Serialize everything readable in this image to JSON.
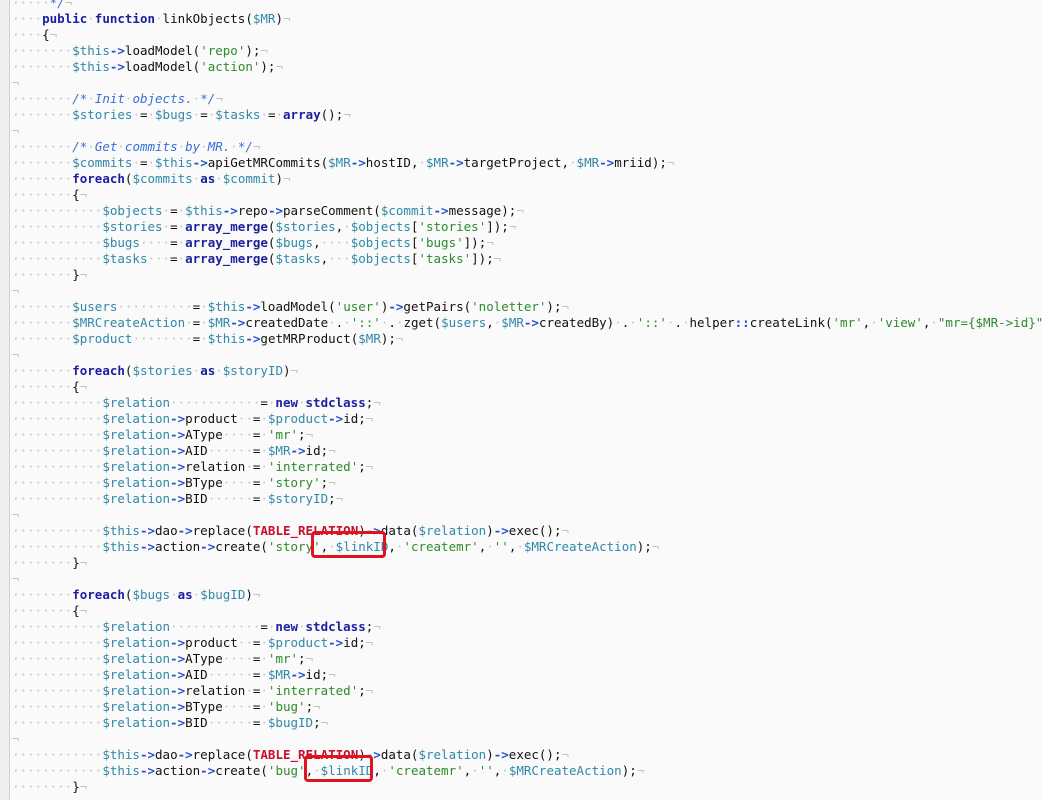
{
  "editor": {
    "lines": [
      "     */",
      "    public function linkObjects($MR)",
      "    {",
      "        $this->loadModel('repo');",
      "        $this->loadModel('action');",
      "",
      "        /* Init objects. */",
      "        $stories = $bugs = $tasks = array();",
      "",
      "        /* Get commits by MR. */",
      "        $commits = $this->apiGetMRCommits($MR->hostID, $MR->targetProject, $MR->mriid);",
      "        foreach($commits as $commit)",
      "        {",
      "            $objects = $this->repo->parseComment($commit->message);",
      "            $stories = array_merge($stories, $objects['stories']);",
      "            $bugs    = array_merge($bugs,    $objects['bugs']);",
      "            $tasks   = array_merge($tasks,   $objects['tasks']);",
      "        }",
      "",
      "        $users          = $this->loadModel('user')->getPairs('noletter');",
      "        $MRCreateAction = $MR->createdDate . '::' . zget($users, $MR->createdBy) . '::' . helper::createLink('mr', 'view', \"mr={$MR->id}\");",
      "        $product        = $this->getMRProduct($MR);",
      "",
      "        foreach($stories as $storyID)",
      "        {",
      "            $relation            = new stdclass;",
      "            $relation->product  = $product->id;",
      "            $relation->AType    = 'mr';",
      "            $relation->AID      = $MR->id;",
      "            $relation->relation = 'interrated';",
      "            $relation->BType    = 'story';",
      "            $relation->BID      = $storyID;",
      "",
      "            $this->dao->replace(TABLE_RELATION)->data($relation)->exec();",
      "            $this->action->create('story', $linkID, 'createmr', '', $MRCreateAction);",
      "        }",
      "",
      "        foreach($bugs as $bugID)",
      "        {",
      "            $relation            = new stdclass;",
      "            $relation->product  = $product->id;",
      "            $relation->AType    = 'mr';",
      "            $relation->AID      = $MR->id;",
      "            $relation->relation = 'interrated';",
      "            $relation->BType    = 'bug';",
      "            $relation->BID      = $bugID;",
      "",
      "            $this->dao->replace(TABLE_RELATION)->data($relation)->exec();",
      "            $this->action->create('bug', $linkID, 'createmr', '', $MRCreateAction);",
      "        }"
    ]
  },
  "colors": {
    "highlight_box": "#e0141e",
    "variable": "#2f88a8",
    "keyword": "#1b1f9e",
    "string": "#2d8a2d",
    "comment": "#3b6fd6",
    "constant": "#c8102e"
  }
}
